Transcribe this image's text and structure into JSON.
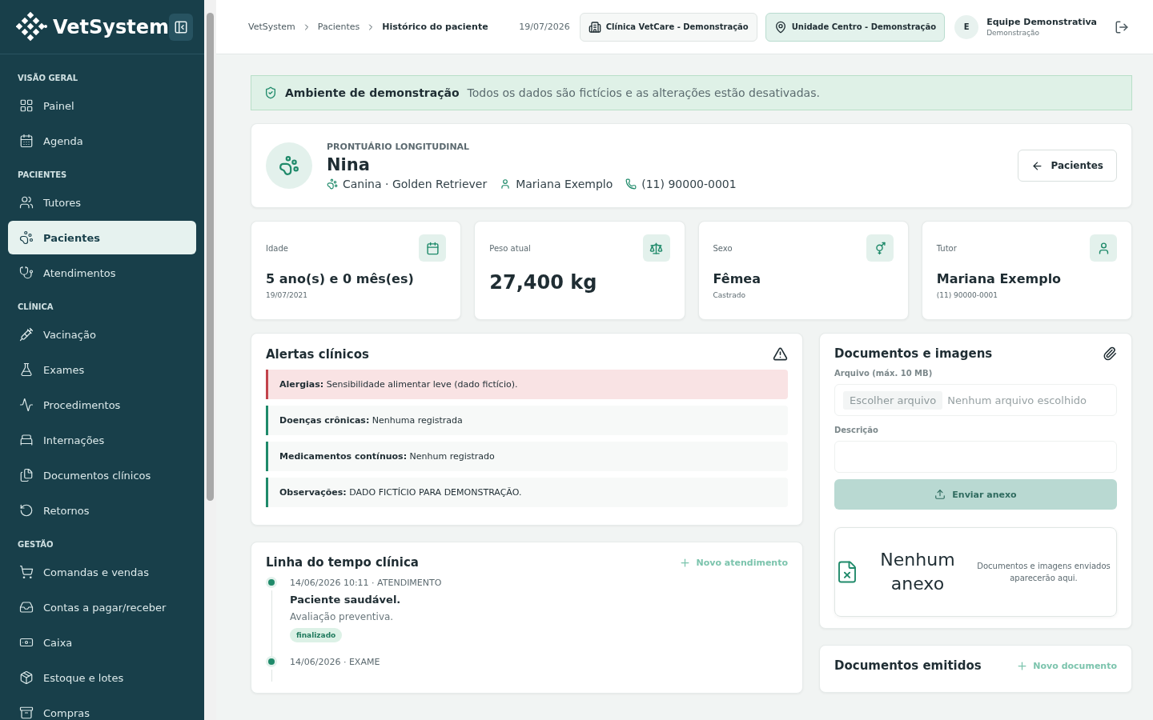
{
  "sidebar": {
    "brand": "VetSystem",
    "sections": [
      {
        "title": "VISÃO GERAL",
        "items": [
          {
            "label": "Painel",
            "kind": "grid",
            "selected": false
          },
          {
            "label": "Agenda",
            "kind": "calendar",
            "selected": false
          }
        ]
      },
      {
        "title": "PACIENTES",
        "items": [
          {
            "label": "Tutores",
            "kind": "users",
            "selected": false
          },
          {
            "label": "Pacientes",
            "kind": "paw",
            "selected": true
          },
          {
            "label": "Atendimentos",
            "kind": "stethoscope",
            "selected": false
          }
        ]
      },
      {
        "title": "CLÍNICA",
        "items": [
          {
            "label": "Vacinação",
            "kind": "syringe",
            "selected": false
          },
          {
            "label": "Exames",
            "kind": "flask",
            "selected": false
          },
          {
            "label": "Procedimentos",
            "kind": "activity",
            "selected": false
          },
          {
            "label": "Internações",
            "kind": "bed",
            "selected": false
          },
          {
            "label": "Documentos clínicos",
            "kind": "files",
            "selected": false
          },
          {
            "label": "Retornos",
            "kind": "rotate",
            "selected": false
          }
        ]
      },
      {
        "title": "GESTÃO",
        "items": [
          {
            "label": "Comandas e vendas",
            "kind": "cart",
            "selected": false
          },
          {
            "label": "Contas a pagar/receber",
            "kind": "inbox",
            "selected": false
          },
          {
            "label": "Caixa",
            "kind": "cash",
            "selected": false
          },
          {
            "label": "Estoque e lotes",
            "kind": "package",
            "selected": false
          },
          {
            "label": "Compras",
            "kind": "archive",
            "selected": false
          }
        ]
      }
    ]
  },
  "topbar": {
    "breadcrumbs": [
      "VetSystem",
      "Pacientes",
      "Histórico do paciente"
    ],
    "date": "19/07/2026",
    "clinic": "Clínica VetCare - Demonstração",
    "unit": "Unidade Centro - Demonstração",
    "user": {
      "initial": "E",
      "name": "Equipe Demonstrativa",
      "role": "Demonstração"
    }
  },
  "banner": {
    "title": "Ambiente de demonstração",
    "text": "Todos os dados são fictícios e as alterações estão desativadas."
  },
  "patient": {
    "eyebrow": "PRONTUÁRIO LONGITUDINAL",
    "name": "Nina",
    "species": "Canina · Golden Retriever",
    "tutor": "Mariana Exemplo",
    "phone": "(11) 90000-0001",
    "back_button": "Pacientes"
  },
  "stats": [
    {
      "label": "Idade",
      "value": "5 ano(s) e 0 mês(es)",
      "sub": "19/07/2021",
      "kind": "calendar",
      "large": false
    },
    {
      "label": "Peso atual",
      "value": "27,400 kg",
      "kind": "scale",
      "large": true
    },
    {
      "label": "Sexo",
      "value": "Fêmea",
      "sub": "Castrado",
      "kind": "sex",
      "large": false
    },
    {
      "label": "Tutor",
      "value": "Mariana Exemplo",
      "sub": "(11) 90000-0001",
      "kind": "user",
      "large": false
    }
  ],
  "alerts": {
    "title": "Alertas clínicos",
    "items": [
      {
        "text": "**Alergias:** Sensibilidade alimentar leve (dado fictício).",
        "kind": "danger"
      },
      {
        "text": "**Doenças crônicas:** Nenhuma registrada",
        "kind": "normal"
      },
      {
        "text": "**Medicamentos contínuos:** Nenhum registrado",
        "kind": "normal"
      },
      {
        "text": "**Observações:** DADO FICTÍCIO PARA DEMONSTRAÇÃO.",
        "kind": "normal"
      }
    ]
  },
  "timeline": {
    "title": "Linha do tempo clínica",
    "action": "Novo atendimento",
    "entries": [
      {
        "meta": "14/06/2026 10:11 · ATENDIMENTO",
        "title": "Paciente saudável.",
        "text": "Avaliação preventiva.",
        "status": "finalizado"
      },
      {
        "meta": "14/06/2026 · EXAME"
      }
    ]
  },
  "attachments": {
    "title": "Documentos e imagens",
    "file_label": "Arquivo (máx. 10 MB)",
    "file_button": "Escolher arquivo",
    "file_value": "Nenhum arquivo escolhido",
    "description_label": "Descrição",
    "submit": "Enviar anexo",
    "submit_disabled": true,
    "empty_title": "Nenhum anexo",
    "empty_text": "Documentos e imagens enviados aparecerão aqui."
  },
  "issued": {
    "title": "Documentos emitidos",
    "action": "Novo documento"
  }
}
